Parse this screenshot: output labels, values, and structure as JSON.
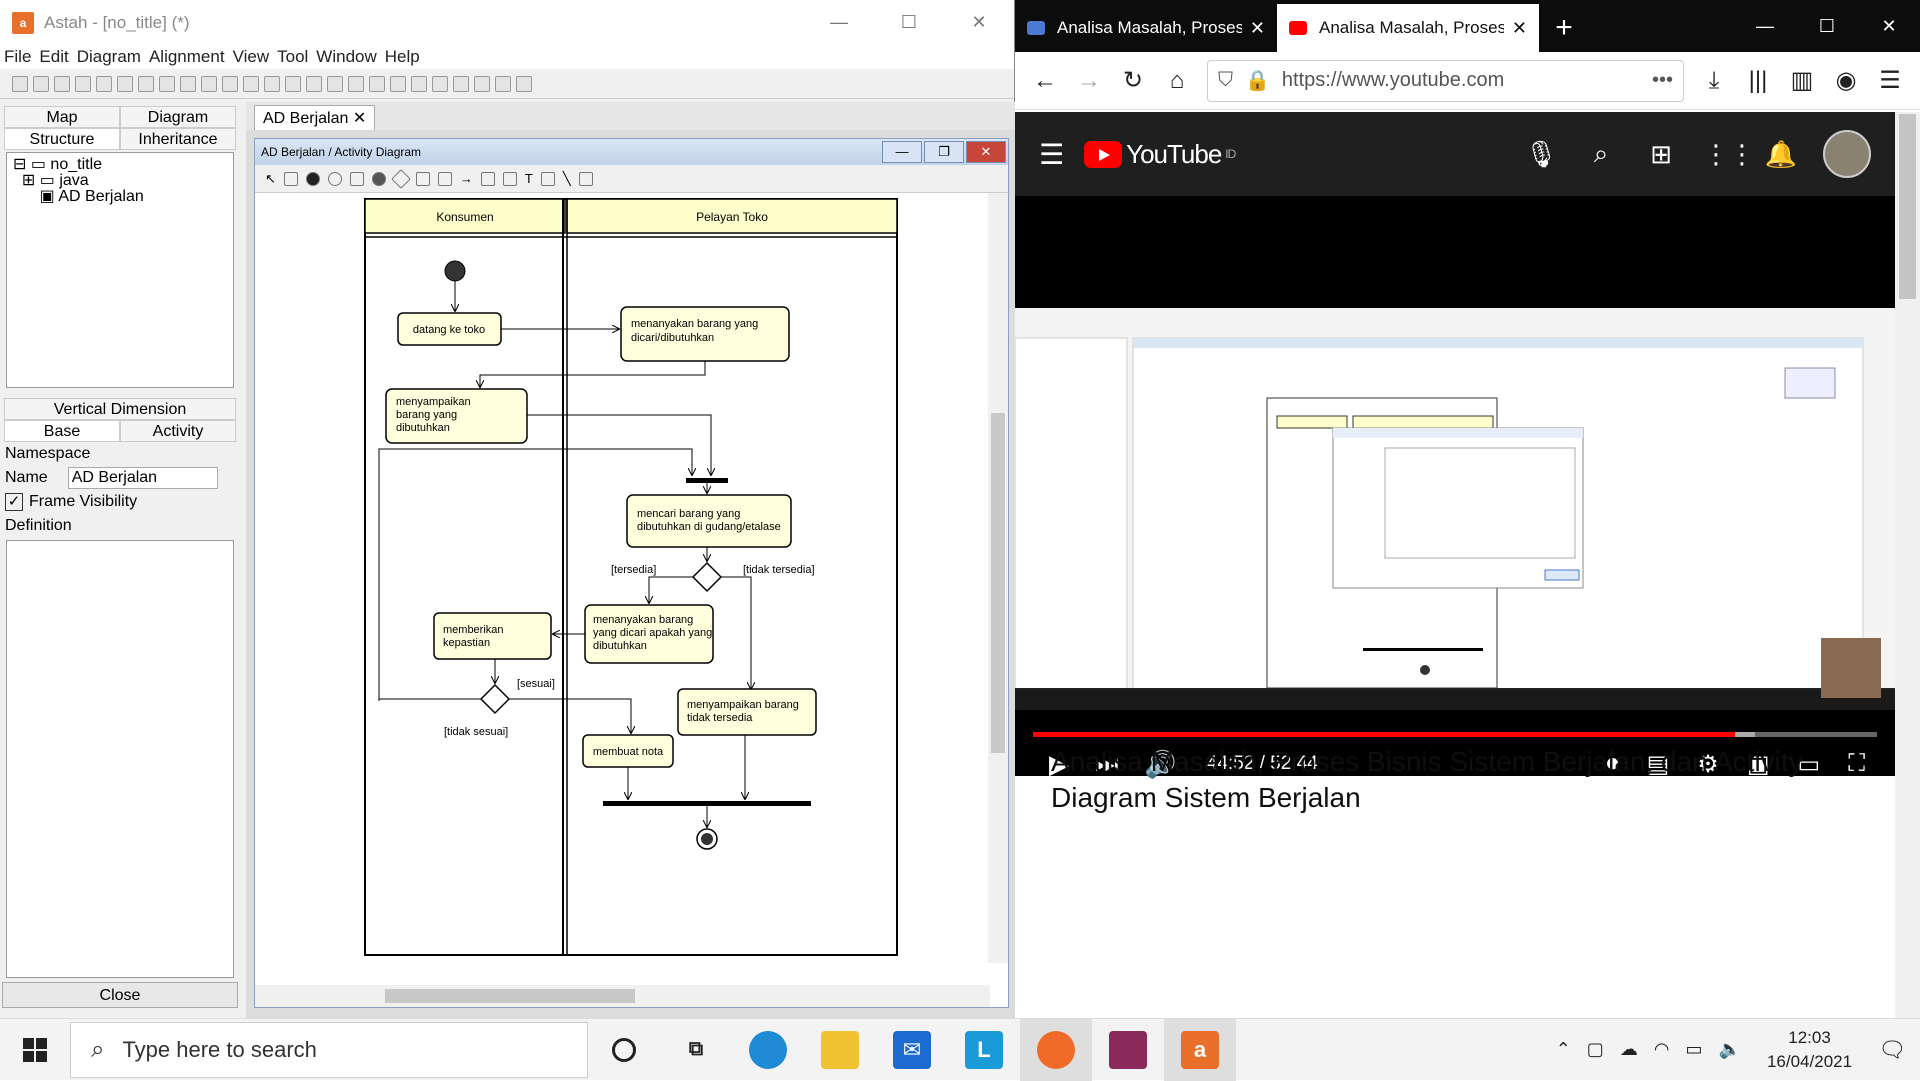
{
  "astah": {
    "title": "Astah - [no_title] (*)",
    "menu": [
      "File",
      "Edit",
      "Diagram",
      "Alignment",
      "View",
      "Tool",
      "Window",
      "Help"
    ],
    "tabs_top": [
      "Map",
      "Diagram"
    ],
    "tabs_bottom": [
      "Structure",
      "Inheritance"
    ],
    "tree": [
      "no_title",
      "java",
      "AD Berjalan"
    ],
    "vertical_dimension": "Vertical Dimension",
    "prop_tabs": [
      "Base",
      "Activity"
    ],
    "namespace_label": "Namespace",
    "name_label": "Name",
    "name_value": "AD Berjalan",
    "frame_visibility": "Frame Visibility",
    "definition_label": "Definition",
    "close_label": "Close",
    "doc_tab": "AD Berjalan",
    "inner_title": "AD Berjalan / Activity Diagram"
  },
  "diagram": {
    "lanes": [
      "Konsumen",
      "Pelayan Toko"
    ],
    "actions": [
      "datang ke toko",
      "menanyakan barang yang dicari/dibutuhkan",
      "menyampaikan barang yang dibutuhkan",
      "mencari barang yang dibutuhkan di gudang/etalase",
      "menanyakan barang yang dicari apakah yang dibutuhkan",
      "memberikan kepastian",
      "menyampaikan barang tidak tersedia",
      "membuat nota"
    ],
    "guards": [
      "[tersedia]",
      "[tidak tersedia]",
      "[sesuai]",
      "[tidak sesuai]"
    ]
  },
  "firefox": {
    "tabs": [
      "Analisa Masalah, Proses",
      "Analisa Masalah, Proses"
    ],
    "url": "https://www.youtube.com",
    "yt_logo": "YouTube",
    "yt_region": "ID",
    "time": "44:52 / 52:44",
    "progress_fraction": 0.855,
    "video_title": "Analisa Masalah, Proses Bisnis Sistem Berjalan, dan Activity Diagram Sistem Berjalan"
  },
  "taskbar": {
    "search_placeholder": "Type here to search",
    "time": "12:03",
    "date": "16/04/2021"
  },
  "colors": {
    "action_fill": "#ffffde",
    "youtube_red": "#ff0000",
    "astah_orange": "#e8702a"
  }
}
